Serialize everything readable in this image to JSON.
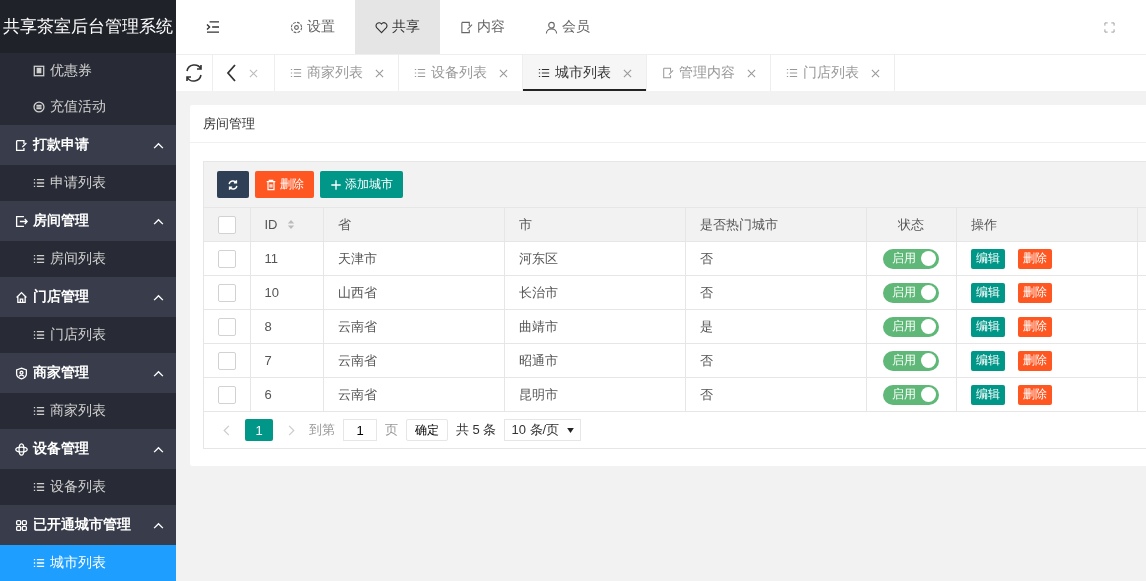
{
  "sidebar": {
    "title": "共享茶室后台管理系统",
    "items": [
      {
        "kind": "sub",
        "label": "优惠券",
        "selected": false
      },
      {
        "kind": "sub",
        "label": "充值活动",
        "selected": false
      },
      {
        "kind": "group",
        "label": "打款申请",
        "expanded": true
      },
      {
        "kind": "sub",
        "label": "申请列表",
        "selected": false
      },
      {
        "kind": "group",
        "label": "房间管理",
        "expanded": true
      },
      {
        "kind": "sub",
        "label": "房间列表",
        "selected": false
      },
      {
        "kind": "group",
        "label": "门店管理",
        "expanded": true
      },
      {
        "kind": "sub",
        "label": "门店列表",
        "selected": false
      },
      {
        "kind": "group",
        "label": "商家管理",
        "expanded": true
      },
      {
        "kind": "sub",
        "label": "商家列表",
        "selected": false
      },
      {
        "kind": "group",
        "label": "设备管理",
        "expanded": true
      },
      {
        "kind": "sub",
        "label": "设备列表",
        "selected": false
      },
      {
        "kind": "group",
        "label": "已开通城市管理",
        "expanded": true
      },
      {
        "kind": "sub",
        "label": "城市列表",
        "selected": true
      }
    ]
  },
  "top_nav": [
    {
      "label": "设置",
      "selected": false
    },
    {
      "label": "共享",
      "selected": true
    },
    {
      "label": "内容",
      "selected": false
    },
    {
      "label": "会员",
      "selected": false
    }
  ],
  "tabs": [
    {
      "label": "商家列表",
      "selected": false
    },
    {
      "label": "设备列表",
      "selected": false
    },
    {
      "label": "城市列表",
      "selected": true
    },
    {
      "label": "管理内容",
      "selected": false
    },
    {
      "label": "门店列表",
      "selected": false
    }
  ],
  "card": {
    "title": "房间管理",
    "toolbar": [
      {
        "kind": "refresh"
      },
      {
        "kind": "delete",
        "label": "删除"
      },
      {
        "kind": "add",
        "label": "添加城市"
      }
    ],
    "table": {
      "select_all_checked": false,
      "columns": [
        {
          "label": "ID",
          "sortable": true
        },
        {
          "label": "省",
          "sortable": false
        },
        {
          "label": "市",
          "sortable": false
        },
        {
          "label": "是否热门城市",
          "sortable": false
        },
        {
          "label": "状态",
          "sortable": false
        },
        {
          "label": "操作",
          "sortable": false
        }
      ],
      "rows": [
        {
          "checked": false,
          "id": "11",
          "province": "天津市",
          "city": "河东区",
          "hot": "否",
          "status": {
            "label": "启用",
            "on": true
          },
          "actions": [
            "编辑",
            "删除"
          ]
        },
        {
          "checked": false,
          "id": "10",
          "province": "山西省",
          "city": "长治市",
          "hot": "否",
          "status": {
            "label": "启用",
            "on": true
          },
          "actions": [
            "编辑",
            "删除"
          ]
        },
        {
          "checked": false,
          "id": "8",
          "province": "云南省",
          "city": "曲靖市",
          "hot": "是",
          "status": {
            "label": "启用",
            "on": true
          },
          "actions": [
            "编辑",
            "删除"
          ]
        },
        {
          "checked": false,
          "id": "7",
          "province": "云南省",
          "city": "昭通市",
          "hot": "否",
          "status": {
            "label": "启用",
            "on": true
          },
          "actions": [
            "编辑",
            "删除"
          ]
        },
        {
          "checked": false,
          "id": "6",
          "province": "云南省",
          "city": "昆明市",
          "hot": "否",
          "status": {
            "label": "启用",
            "on": true
          },
          "actions": [
            "编辑",
            "删除"
          ]
        }
      ]
    },
    "pagination": {
      "pages": [
        {
          "label": "1",
          "selected": true
        }
      ],
      "goto_label": "到第",
      "page_input": "1",
      "page_unit": "页",
      "confirm": "确定",
      "total": "共 5 条",
      "page_size": "10 条/页"
    }
  }
}
